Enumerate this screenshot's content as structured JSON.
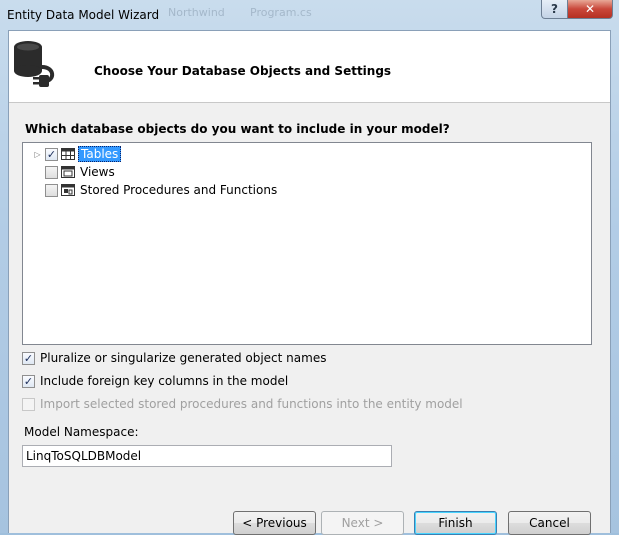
{
  "window": {
    "title": "Entity Data Model Wizard",
    "help_glyph": "?",
    "close_glyph": "✕",
    "background_ghost_text": [
      "Northwind",
      "Program.cs"
    ]
  },
  "header": {
    "title": "Choose Your Database Objects and Settings",
    "icon": "database-plug-icon"
  },
  "objects": {
    "question": "Which database objects do you want to include in your model?",
    "items": [
      {
        "label": "Tables",
        "checked": true,
        "selected": true,
        "expander": "▷",
        "icon": "table-icon"
      },
      {
        "label": "Views",
        "checked": false,
        "selected": false,
        "icon": "view-icon"
      },
      {
        "label": "Stored Procedures and Functions",
        "checked": false,
        "selected": false,
        "icon": "stored-procedure-icon"
      }
    ]
  },
  "options": [
    {
      "label": "Pluralize or singularize generated object names",
      "checked": true,
      "enabled": true
    },
    {
      "label": "Include foreign key columns in the model",
      "checked": true,
      "enabled": true
    },
    {
      "label": "Import selected stored procedures and functions into the entity model",
      "checked": false,
      "enabled": false
    }
  ],
  "namespace": {
    "label": "Model Namespace:",
    "value": "LinqToSQLDBModel"
  },
  "buttons": {
    "previous": "< Previous",
    "next": "Next >",
    "finish": "Finish",
    "cancel": "Cancel"
  },
  "colors": {
    "selection": "#3399ff",
    "close_button": "#c9473a",
    "frame": "#b3cde6"
  }
}
